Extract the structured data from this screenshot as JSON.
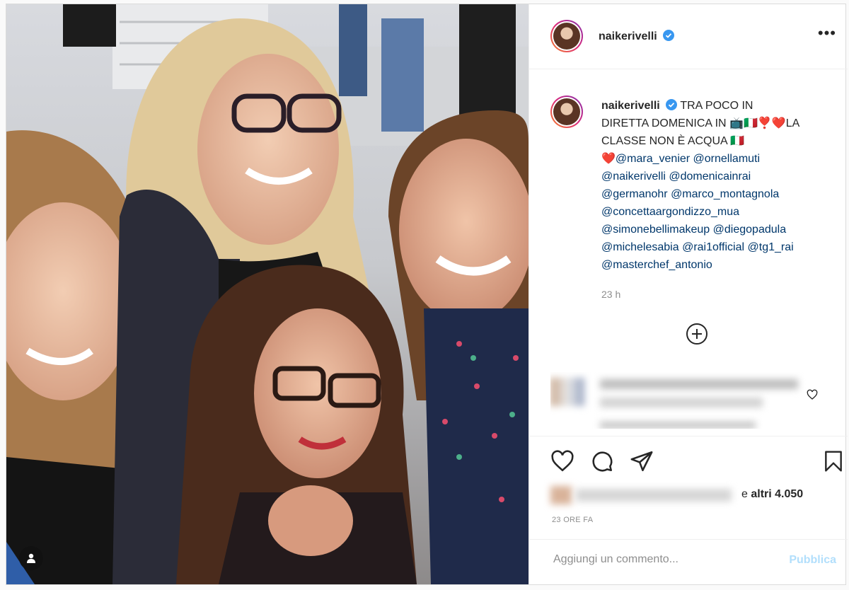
{
  "post": {
    "username": "naikerivelli",
    "caption_lines": [
      "TRA POCO IN",
      "DIRETTA DOMENICA IN 📺🇮🇹❣️❤️LA",
      "CLASSE NON È ACQUA 🇮🇹"
    ],
    "mention_lines": [
      "❤️@mara_venier @ornellamuti",
      "@naikerivelli @domenicainrai",
      "@germanohr @marco_montagnola",
      "@concettaargondizzo_mua",
      "@simonebellimakeup @diegopadula",
      "@michelesabia @rai1official @tg1_rai",
      "@masterchef_antonio"
    ],
    "time_short": "23 h",
    "likes_prefix": "e",
    "likes_count": "altri 4.050",
    "time_long": "23 ORE FA",
    "comment_placeholder": "Aggiungi un commento...",
    "publish_label": "Pubblica",
    "more_label": "•••"
  },
  "colors": {
    "verified": "#3897f0",
    "mention": "#00376b",
    "publish": "#b2dffc"
  }
}
